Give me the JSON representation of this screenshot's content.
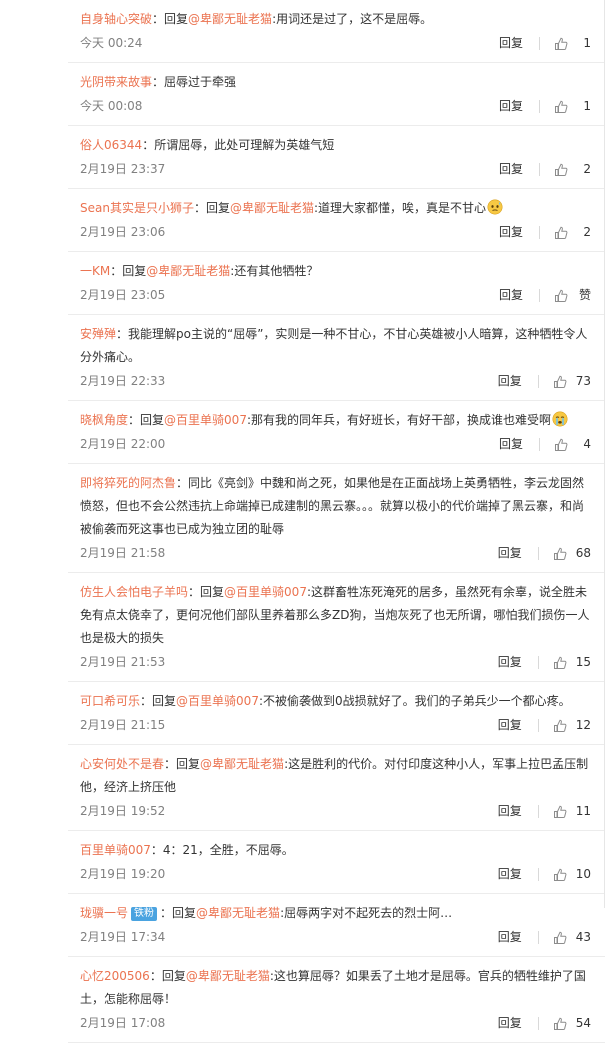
{
  "reply_label": "回复",
  "comments": [
    {
      "user": "自身轴心突破",
      "reply_prefix": "回复",
      "mention": "@卑鄙无耻老猫",
      "text": ":用词还是过了，这不是屈辱。",
      "time": "今天 00:24",
      "likes": "1"
    },
    {
      "user": "光阴带来故事",
      "reply_prefix": "",
      "mention": "",
      "text": "：屈辱过于牵强",
      "time": "今天 00:08",
      "likes": "1"
    },
    {
      "user": "俗人06344",
      "reply_prefix": "",
      "mention": "",
      "text": "：所谓屈辱，此处可理解为英雄气短",
      "time": "2月19日 23:37",
      "likes": "2"
    },
    {
      "user": "Sean其实是只小狮子",
      "reply_prefix": "回复",
      "mention": "@卑鄙无耻老猫",
      "text": ":道理大家都懂，唉，真是不甘心",
      "emoji": "sweat-face",
      "time": "2月19日 23:06",
      "likes": "2"
    },
    {
      "user": "一KM",
      "reply_prefix": "回复",
      "mention": "@卑鄙无耻老猫",
      "text": ":还有其他牺牲？",
      "time": "2月19日 23:05",
      "likes": "赞"
    },
    {
      "user": "安殚殚",
      "reply_prefix": "",
      "mention": "",
      "text": "：我能理解po主说的“屈辱”，实则是一种不甘心，不甘心英雄被小人暗算，这种牺牲令人分外痛心。",
      "time": "2月19日 22:33",
      "likes": "73"
    },
    {
      "user": "晓枫角度",
      "reply_prefix": "回复",
      "mention": "@百里单骑007",
      "text": ":那有我的同年兵，有好班长，有好干部，换成谁也难受啊",
      "emoji": "crying-face",
      "time": "2月19日 22:00",
      "likes": "4"
    },
    {
      "user": "即将猝死的阿杰鲁",
      "reply_prefix": "",
      "mention": "",
      "text": "：同比《亮剑》中魏和尚之死，如果他是在正面战场上英勇牺牲，李云龙固然愤怒，但也不会公然违抗上命端掉已成建制的黑云寨。。。就算以极小的代价端掉了黑云寨，和尚被偷袭而死这事也已成为独立团的耻辱",
      "time": "2月19日 21:58",
      "likes": "68"
    },
    {
      "user": "仿生人会怕电子羊吗",
      "reply_prefix": "回复",
      "mention": "@百里单骑007",
      "text": ":这群畜牲冻死淹死的居多，虽然死有余辜，说全胜未免有点太侥幸了，更何况他们部队里养着那么多ZD狗，当炮灰死了也无所谓，哪怕我们损伤一人也是极大的损失",
      "time": "2月19日 21:53",
      "likes": "15"
    },
    {
      "user": "可口希可乐",
      "reply_prefix": "回复",
      "mention": "@百里单骑007",
      "text": ":不被偷袭做到0战损就好了。我们的子弟兵少一个都心疼。",
      "time": "2月19日 21:15",
      "likes": "12"
    },
    {
      "user": "心安何处不是春",
      "reply_prefix": "回复",
      "mention": "@卑鄙无耻老猫",
      "text": ":这是胜利的代价。对付印度这种小人，军事上拉巴孟压制他，经济上挤压他",
      "time": "2月19日 19:52",
      "likes": "11"
    },
    {
      "user": "百里单骑007",
      "reply_prefix": "",
      "mention": "",
      "text": "：4：21，全胜，不屈辱。",
      "time": "2月19日 19:20",
      "likes": "10"
    },
    {
      "user": "珑骥一号",
      "badge": "铁粉",
      "reply_prefix": "回复",
      "mention": "@卑鄙无耻老猫",
      "text": ":屈辱两字对不起死去的烈士阿…",
      "time": "2月19日 17:34",
      "likes": "43"
    },
    {
      "user": "心忆200506",
      "reply_prefix": "回复",
      "mention": "@卑鄙无耻老猫",
      "text": ":这也算屈辱？如果丢了土地才是屈辱。官兵的牺牲维护了国土，怎能称屈辱！",
      "time": "2月19日 17:08",
      "likes": "54"
    }
  ]
}
